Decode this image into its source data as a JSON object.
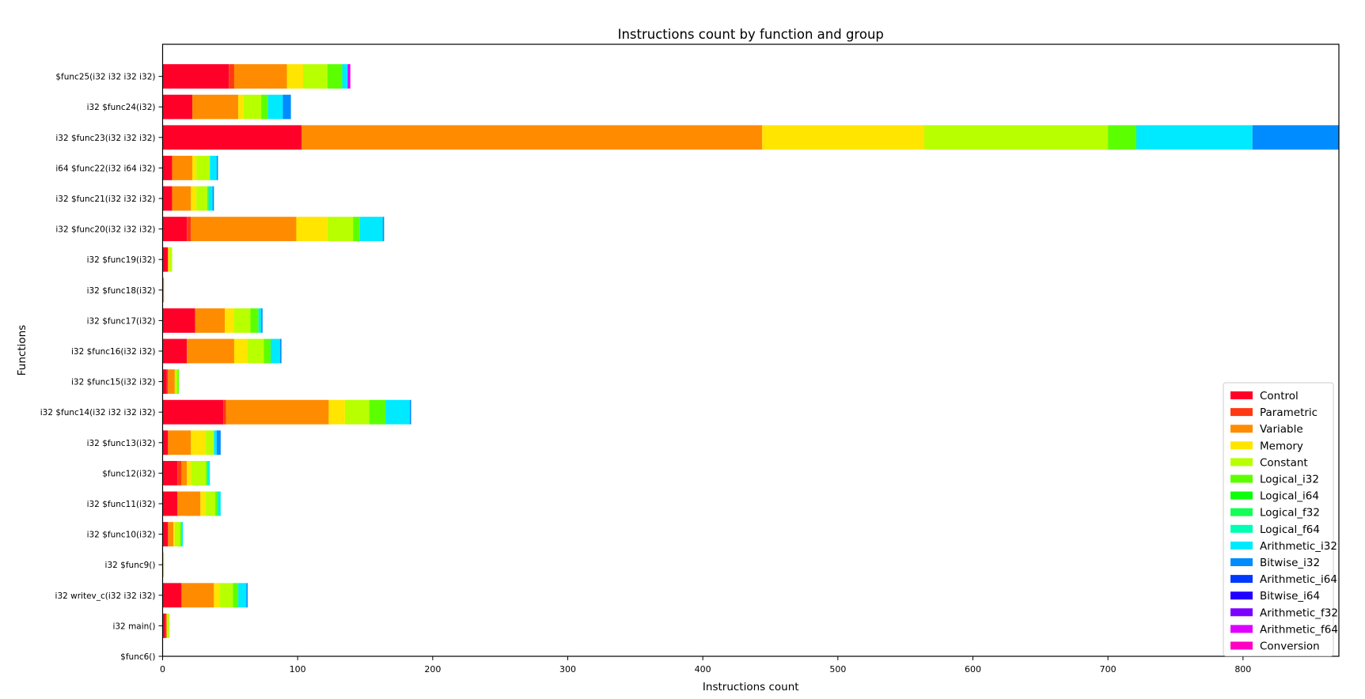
{
  "chart_data": {
    "type": "bar",
    "orientation": "horizontal",
    "stacked": true,
    "title": "Instructions count by function and group",
    "xlabel": "Instructions count",
    "ylabel": "Functions",
    "xlim": [
      0,
      871
    ],
    "xticks": [
      0,
      100,
      200,
      300,
      400,
      500,
      600,
      700,
      800
    ],
    "grid": false,
    "legend_position": "bottom-right",
    "categories": [
      "$func6()",
      "i32 main()",
      "i32 writev_c(i32 i32 i32)",
      "i32 $func9()",
      "i32 $func10(i32)",
      "i32 $func11(i32)",
      "$func12(i32)",
      "i32 $func13(i32)",
      "i32 $func14(i32 i32 i32 i32)",
      "i32 $func15(i32 i32)",
      "i32 $func16(i32 i32)",
      "i32 $func17(i32)",
      "i32 $func18(i32)",
      "i32 $func19(i32)",
      "i32 $func20(i32 i32 i32)",
      "i32 $func21(i32 i32 i32)",
      "i64 $func22(i32 i64 i32)",
      "i32 $func23(i32 i32 i32)",
      "i32 $func24(i32)",
      "$func25(i32 i32 i32 i32)"
    ],
    "series": [
      {
        "name": "Control",
        "color": "#ff0029",
        "values": [
          0,
          2,
          14,
          0,
          4,
          11,
          11,
          4,
          45,
          3,
          18,
          24,
          0,
          4,
          18,
          7,
          7,
          103,
          22,
          49
        ]
      },
      {
        "name": "Parametric",
        "color": "#ff3a12",
        "values": [
          0,
          1,
          0,
          0,
          0,
          0,
          3,
          0,
          2,
          1,
          0,
          0,
          0,
          0,
          3,
          0,
          0,
          0,
          0,
          4
        ]
      },
      {
        "name": "Variable",
        "color": "#ff8c00",
        "values": [
          0,
          0,
          24,
          0,
          4,
          17,
          4,
          17,
          76,
          5,
          35,
          22,
          1,
          0,
          78,
          14,
          15,
          341,
          34,
          39
        ]
      },
      {
        "name": "Memory",
        "color": "#ffe500",
        "values": [
          0,
          0,
          4,
          0,
          1,
          4,
          3,
          11,
          12,
          0,
          10,
          7,
          0,
          1,
          23,
          4,
          3,
          120,
          4,
          12
        ]
      },
      {
        "name": "Constant",
        "color": "#b8ff00",
        "values": [
          0,
          2,
          10,
          1,
          4,
          7,
          11,
          6,
          18,
          2,
          12,
          12,
          0,
          2,
          19,
          8,
          10,
          136,
          13,
          18
        ]
      },
      {
        "name": "Logical_i32",
        "color": "#5cff00",
        "values": [
          0,
          0,
          4,
          0,
          1,
          2,
          1,
          0,
          12,
          1,
          5,
          6,
          0,
          0,
          5,
          1,
          0,
          21,
          5,
          11
        ]
      },
      {
        "name": "Logical_i64",
        "color": "#0dff0d",
        "values": [
          0,
          0,
          0,
          0,
          0,
          0,
          0,
          0,
          0,
          0,
          0,
          0,
          0,
          0,
          0,
          0,
          0,
          0,
          0,
          0
        ]
      },
      {
        "name": "Logical_f32",
        "color": "#12ff55",
        "values": [
          0,
          0,
          0,
          0,
          0,
          0,
          0,
          0,
          0,
          0,
          0,
          0,
          0,
          0,
          0,
          0,
          0,
          0,
          0,
          0
        ]
      },
      {
        "name": "Logical_f64",
        "color": "#00ffb2",
        "values": [
          0,
          0,
          0,
          0,
          0,
          0,
          1,
          0,
          0,
          0,
          0,
          0,
          0,
          0,
          0,
          0,
          0,
          0,
          0,
          0
        ]
      },
      {
        "name": "Arithmetic_i32",
        "color": "#00eaff",
        "values": [
          0,
          0,
          6,
          0,
          1,
          2,
          1,
          2,
          18,
          0,
          7,
          2,
          0,
          0,
          17,
          3,
          5,
          86,
          11,
          4
        ]
      },
      {
        "name": "Bitwise_i32",
        "color": "#008cff",
        "values": [
          0,
          0,
          1,
          0,
          0,
          0,
          0,
          3,
          1,
          0,
          1,
          1,
          0,
          0,
          1,
          1,
          1,
          64,
          6,
          0
        ]
      },
      {
        "name": "Arithmetic_i64",
        "color": "#0038ff",
        "values": [
          0,
          0,
          0,
          0,
          0,
          0,
          0,
          0,
          0,
          0,
          0,
          0,
          0,
          0,
          0,
          0,
          0,
          0,
          0,
          0
        ]
      },
      {
        "name": "Bitwise_i64",
        "color": "#2200ff",
        "values": [
          0,
          0,
          0,
          0,
          0,
          0,
          0,
          0,
          0,
          0,
          0,
          0,
          0,
          0,
          0,
          0,
          0,
          0,
          0,
          0
        ]
      },
      {
        "name": "Arithmetic_f32",
        "color": "#7c00ff",
        "values": [
          0,
          0,
          0,
          0,
          0,
          0,
          0,
          0,
          0,
          0,
          0,
          0,
          0,
          0,
          0,
          0,
          0,
          0,
          0,
          0
        ]
      },
      {
        "name": "Arithmetic_f64",
        "color": "#dd00ff",
        "values": [
          0,
          0,
          0,
          0,
          0,
          0,
          0,
          0,
          0,
          0,
          0,
          0,
          0,
          0,
          0,
          0,
          0,
          0,
          0,
          2
        ]
      },
      {
        "name": "Conversion",
        "color": "#ff00c3",
        "values": [
          0,
          0,
          0,
          0,
          0,
          0,
          0,
          0,
          0,
          0,
          0,
          0,
          0,
          0,
          0,
          0,
          0,
          0,
          0,
          0
        ]
      }
    ]
  }
}
